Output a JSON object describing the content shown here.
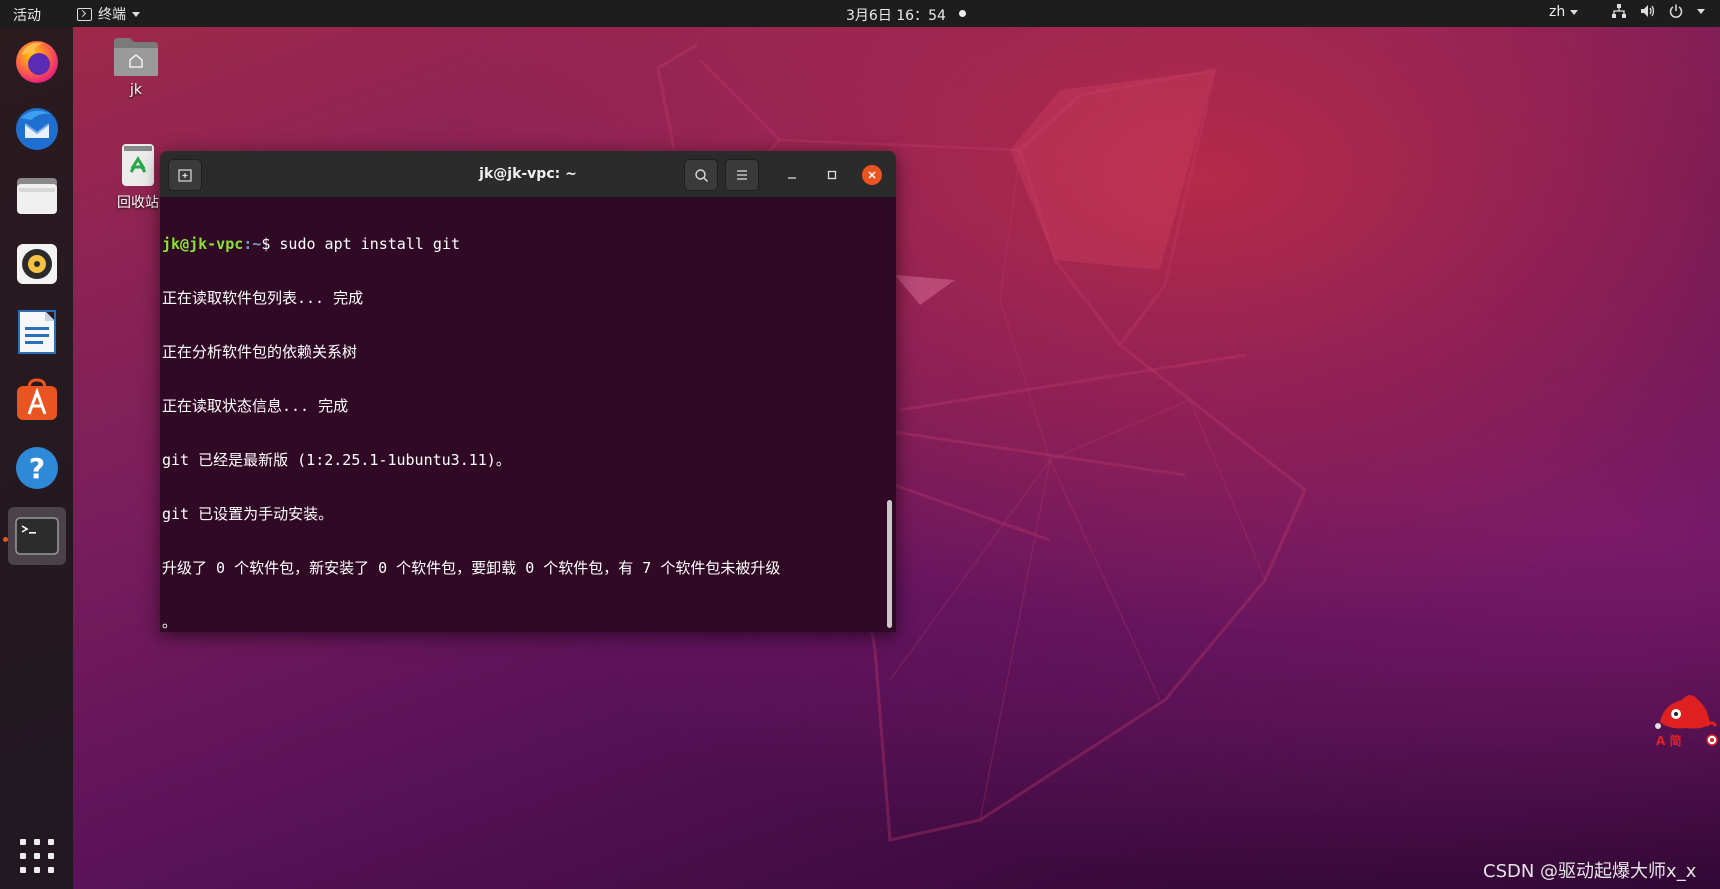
{
  "topbar": {
    "activities": "活动",
    "app_menu": "终端",
    "clock": "3月6日  16：54",
    "language": "zh"
  },
  "dock": {
    "items": [
      {
        "name": "firefox",
        "icon": "firefox-icon"
      },
      {
        "name": "thunderbird",
        "icon": "thunderbird-icon"
      },
      {
        "name": "files",
        "icon": "files-icon"
      },
      {
        "name": "rhythmbox",
        "icon": "rhythmbox-icon"
      },
      {
        "name": "libreoffice-writer",
        "icon": "writer-icon"
      },
      {
        "name": "software",
        "icon": "software-icon"
      },
      {
        "name": "help",
        "icon": "help-icon"
      },
      {
        "name": "terminal",
        "icon": "terminal-icon",
        "running": true
      }
    ]
  },
  "desktop": {
    "home_label": "jk",
    "trash_label": "回收站"
  },
  "terminal": {
    "title": "jk@jk-vpc: ~",
    "prompt_user": "jk@jk-vpc",
    "prompt_path": ":~",
    "prompt_symbol": "$ ",
    "command": "sudo apt install git",
    "output": [
      "正在读取软件包列表... 完成",
      "正在分析软件包的依赖关系树",
      "正在读取状态信息... 完成",
      "git 已经是最新版 (1:2.25.1-1ubuntu3.11)。",
      "git 已设置为手动安装。",
      "升级了 0 个软件包，新安装了 0 个软件包，要卸载 0 个软件包，有 7 个软件包未被升级",
      "。"
    ]
  },
  "mascot_text": "A 简",
  "watermark": "CSDN @驱动起爆大师x_x",
  "colors": {
    "accent": "#e95420",
    "terminal_bg": "#300a24",
    "prompt_user": "#8ae234",
    "prompt_path": "#729fcf"
  }
}
